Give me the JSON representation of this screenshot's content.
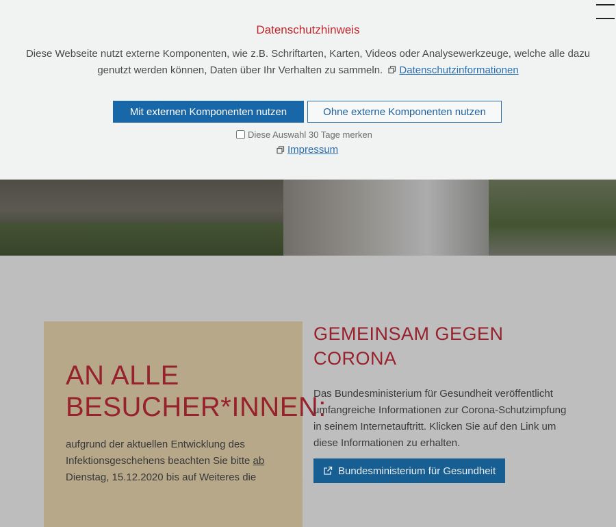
{
  "banner": {
    "title": "Datenschutzhinweis",
    "text": "Diese Webseite nutzt externe Komponenten, wie z.B. Schriftarten, Karten, Videos oder Analysewerkzeuge, welche alle dazu genutzt werden können, Daten über Ihr Verhalten zu sammeln.",
    "privacy_link": "Datenschutzinformationen",
    "accept_label": "Mit externen Komponenten nutzen",
    "decline_label": "Ohne externe Komponenten nutzen",
    "remember_label": "Diese Auswahl 30 Tage merken",
    "remember_checked": false,
    "impressum_link": "Impressum"
  },
  "visitors": {
    "title": "AN ALLE BESUCHER*INNEN:",
    "text_before_link": "aufgrund der aktuellen Entwicklung des Infektionsgeschehens beachten Sie bitte ",
    "link": "ab",
    "text_after_link": " Dienstag, 15.12.2020 bis auf Weiteres die"
  },
  "corona": {
    "title": "GEMEINSAM GEGEN CORONA",
    "text": "Das Bundesministerium für Gesundheit veröffentlicht umfangreiche Informationen zur Corona-Schutzimpfung in seinem Internetauftritt. Klicken Sie auf den Link um diese Informationen zu erhalten.",
    "button_label": "Bundesministerium für Gesundheit"
  },
  "colors": {
    "accent_red": "#97212c",
    "link_blue": "#2a70b0",
    "primary_button": "#1767a9",
    "box_beige": "#b6a889"
  },
  "icons": {
    "menu": "hamburger-menu-icon",
    "copy": "copy-icon",
    "external": "external-link-icon"
  }
}
